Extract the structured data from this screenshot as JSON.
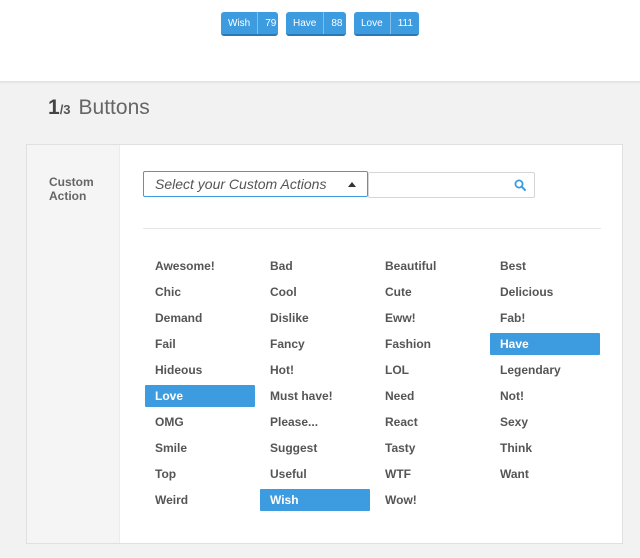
{
  "preview": {
    "buttons": [
      {
        "label": "Wish",
        "count": "79"
      },
      {
        "label": "Have",
        "count": "88"
      },
      {
        "label": "Love",
        "count": "111"
      }
    ]
  },
  "step": {
    "current": "1",
    "total": "/3",
    "title": "Buttons"
  },
  "form": {
    "label_line1": "Custom",
    "label_line2": "Action",
    "select_placeholder": "Select your Custom Actions",
    "search_value": ""
  },
  "colors": {
    "accent": "#3d9be0",
    "accent_dark": "#2a78b5"
  },
  "options": {
    "columns": [
      [
        "Awesome!",
        "Chic",
        "Demand",
        "Fail",
        "Hideous",
        "Love",
        "OMG",
        "Smile",
        "Top",
        "Weird"
      ],
      [
        "Bad",
        "Cool",
        "Dislike",
        "Fancy",
        "Hot!",
        "Must have!",
        "Please...",
        "Suggest",
        "Useful",
        "Wish"
      ],
      [
        "Beautiful",
        "Cute",
        "Eww!",
        "Fashion",
        "LOL",
        "Need",
        "React",
        "Tasty",
        "WTF",
        "Wow!"
      ],
      [
        "Best",
        "Delicious",
        "Fab!",
        "Have",
        "Legendary",
        "Not!",
        "Sexy",
        "Think",
        "Want"
      ]
    ],
    "selected": [
      "Love",
      "Wish",
      "Have"
    ]
  }
}
